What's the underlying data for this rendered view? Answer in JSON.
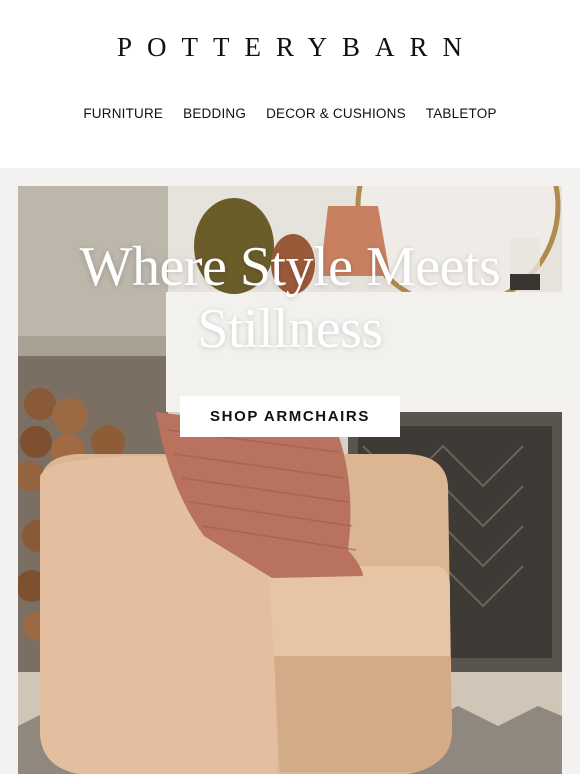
{
  "brand": {
    "logo_text": "POTTERYBARN"
  },
  "nav": {
    "items": [
      {
        "label": "FURNITURE"
      },
      {
        "label": "BEDDING"
      },
      {
        "label": "DECOR & CUSHIONS"
      },
      {
        "label": "TABLETOP"
      }
    ]
  },
  "hero": {
    "headline_line1": "Where Style Meets",
    "headline_line2": "Stillness",
    "cta_label": "SHOP ARMCHAIRS",
    "image_subject": "armchair-living-room-photo"
  },
  "colors": {
    "page_band": "#f4f2f0",
    "headline_text": "#ffffff",
    "cta_background": "#ffffff"
  }
}
